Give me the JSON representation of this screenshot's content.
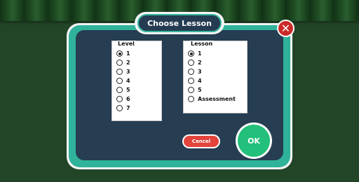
{
  "dialog": {
    "title": "Choose Lesson",
    "close_icon": "close-icon",
    "close_glyph": "✕"
  },
  "level_panel": {
    "title": "Level",
    "options": [
      "1",
      "2",
      "3",
      "4",
      "5",
      "6",
      "7"
    ],
    "selected": "1"
  },
  "lesson_panel": {
    "title": "Lesson",
    "options": [
      "1",
      "2",
      "3",
      "4",
      "5",
      "Assessment"
    ],
    "selected": "1"
  },
  "buttons": {
    "cancel_label": "Cancel",
    "ok_label": "OK"
  },
  "colors": {
    "background": "#224527",
    "dialog_body": "#263d52",
    "dialog_border": "#2fb39a",
    "cancel": "#e2443c",
    "ok": "#22c07a",
    "close": "#cc2a2a"
  }
}
